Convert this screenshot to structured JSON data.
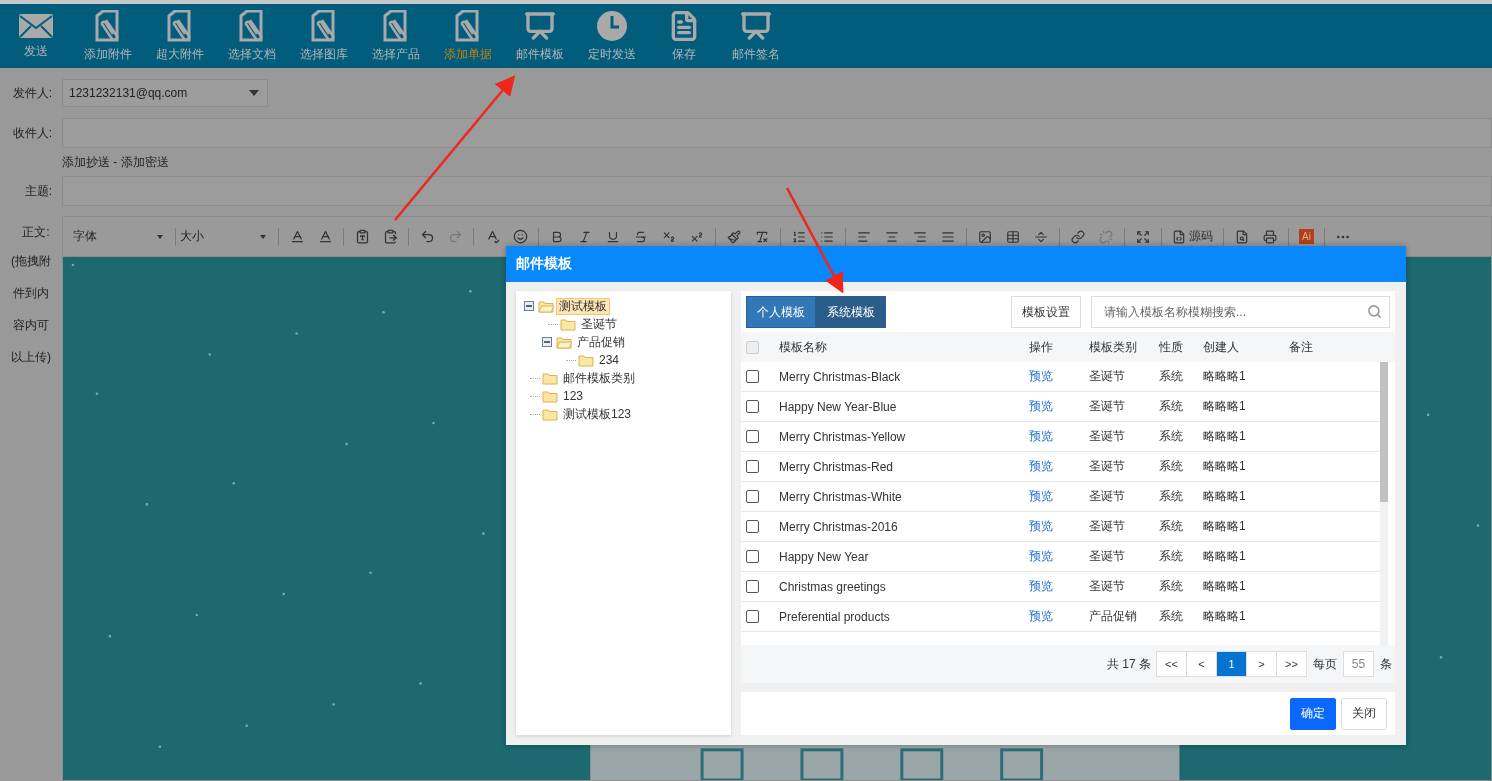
{
  "top_toolbar": [
    {
      "label": "发送",
      "kind": "mail",
      "selected": false
    },
    {
      "label": "添加附件",
      "kind": "attach",
      "selected": false
    },
    {
      "label": "超大附件",
      "kind": "attach",
      "selected": false
    },
    {
      "label": "选择文档",
      "kind": "attach",
      "selected": false
    },
    {
      "label": "选择图库",
      "kind": "attach",
      "selected": false
    },
    {
      "label": "选择产品",
      "kind": "attach",
      "selected": false
    },
    {
      "label": "添加单据",
      "kind": "attach",
      "selected": true
    },
    {
      "label": "邮件模板",
      "kind": "board",
      "selected": false
    },
    {
      "label": "定时发送",
      "kind": "clock",
      "selected": false
    },
    {
      "label": "保存",
      "kind": "doc",
      "selected": false
    },
    {
      "label": "邮件签名",
      "kind": "board",
      "selected": false
    }
  ],
  "form": {
    "sender": {
      "label": "发件人:",
      "value": "1231232131@qq.com"
    },
    "recipient": {
      "label": "收件人:"
    },
    "cc_links": "添加抄送 - 添加密送",
    "subject": {
      "label": "主题:"
    },
    "body": {
      "label": "正文:",
      "hint": "(拖拽附件到内容内可以上传)"
    }
  },
  "editor_toolbar": {
    "font": "字体",
    "size": "大小",
    "source": "源码",
    "ai": "Ai"
  },
  "dialog": {
    "title": "邮件模板",
    "tree": [
      {
        "label": "测试模板",
        "selected": true,
        "expanded": true,
        "children": [
          {
            "label": "圣诞节",
            "selected": false
          },
          {
            "label": "产品促销",
            "selected": false,
            "expanded": true,
            "children": [
              {
                "label": "234",
                "selected": false
              }
            ]
          }
        ]
      },
      {
        "label": "邮件模板类别",
        "selected": false
      },
      {
        "label": "123",
        "selected": false
      },
      {
        "label": "测试模板123",
        "selected": false
      }
    ],
    "tabs": [
      {
        "label": "个人模板",
        "selected": false
      },
      {
        "label": "系统模板",
        "selected": true
      }
    ],
    "settings_button": "模板设置",
    "search": {
      "placeholder": "请输入模板名称模糊搜索..."
    },
    "select_all_checked": false,
    "columns": [
      "模板名称",
      "操作",
      "模板类别",
      "性质",
      "创建人",
      "备注"
    ],
    "rows": [
      {
        "checked": false,
        "name": "Merry Christmas-Black",
        "action": "预览",
        "category": "圣诞节",
        "nature": "系统",
        "creator": "略略略1"
      },
      {
        "checked": false,
        "name": "Happy New Year-Blue",
        "action": "预览",
        "category": "圣诞节",
        "nature": "系统",
        "creator": "略略略1"
      },
      {
        "checked": false,
        "name": "Merry Christmas-Yellow",
        "action": "预览",
        "category": "圣诞节",
        "nature": "系统",
        "creator": "略略略1"
      },
      {
        "checked": false,
        "name": "Merry Christmas-Red",
        "action": "预览",
        "category": "圣诞节",
        "nature": "系统",
        "creator": "略略略1"
      },
      {
        "checked": false,
        "name": "Merry Christmas-White",
        "action": "预览",
        "category": "圣诞节",
        "nature": "系统",
        "creator": "略略略1"
      },
      {
        "checked": false,
        "name": "Merry Christmas-2016",
        "action": "预览",
        "category": "圣诞节",
        "nature": "系统",
        "creator": "略略略1"
      },
      {
        "checked": false,
        "name": "Happy New Year",
        "action": "预览",
        "category": "圣诞节",
        "nature": "系统",
        "creator": "略略略1"
      },
      {
        "checked": false,
        "name": "Christmas greetings",
        "action": "预览",
        "category": "圣诞节",
        "nature": "系统",
        "creator": "略略略1"
      },
      {
        "checked": false,
        "name": "Preferential products",
        "action": "预览",
        "category": "产品促销",
        "nature": "系统",
        "creator": "略略略1"
      }
    ],
    "pagination": {
      "total_prefix": "共",
      "total": "17",
      "total_unit": "条",
      "pages": [
        {
          "label": "<<",
          "selected": false
        },
        {
          "label": "<",
          "selected": false
        },
        {
          "label": "1",
          "selected": true
        },
        {
          "label": ">",
          "selected": false
        },
        {
          "label": ">>",
          "selected": false
        }
      ],
      "per_page_label": "每页",
      "per_page": "55",
      "per_page_unit": "条"
    },
    "buttons": [
      {
        "label": "确定",
        "kind": "primary"
      },
      {
        "label": "关闭",
        "kind": "default"
      }
    ]
  }
}
